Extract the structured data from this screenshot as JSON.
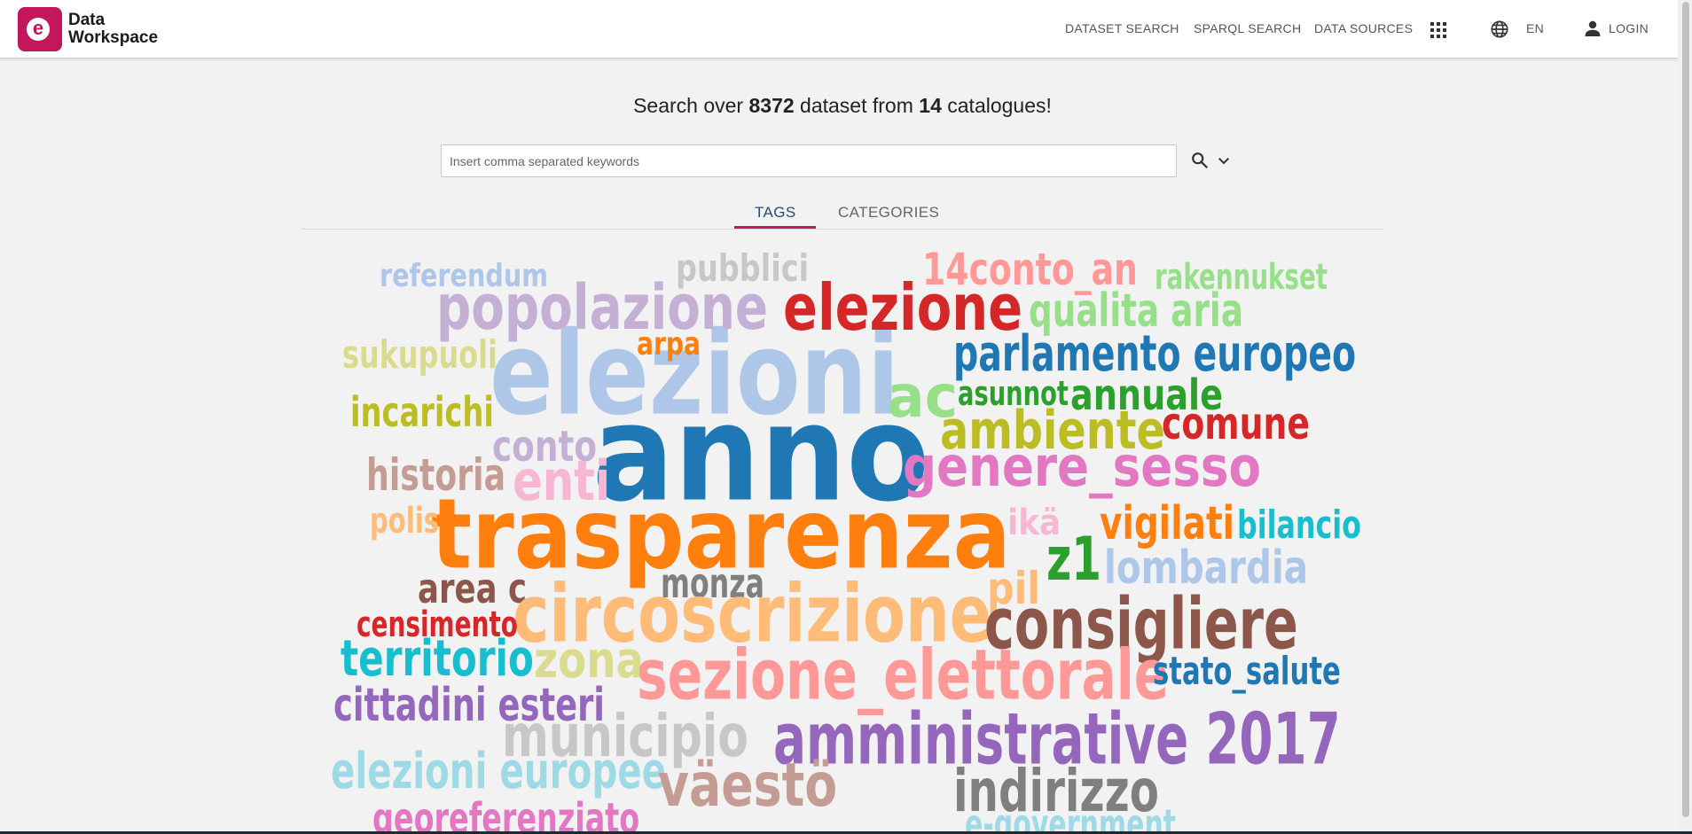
{
  "app": {
    "logo_letter": "e",
    "logo_line1": "Data",
    "logo_line2": "Workspace",
    "brand_color": "#c2185b"
  },
  "nav": {
    "dataset_search": "DATASET SEARCH",
    "sparql_search": "SPARQL SEARCH",
    "data_sources": "DATA SOURCES",
    "language": "EN",
    "login": "LOGIN",
    "icons": [
      "apps-icon",
      "globe-icon",
      "person-icon"
    ]
  },
  "headline": {
    "prefix": "Search over ",
    "dataset_count": "8372",
    "middle": " dataset from ",
    "catalogue_count": "14",
    "suffix": " catalogues!"
  },
  "search": {
    "placeholder": "Insert comma separated keywords",
    "value": "",
    "icons": [
      "search-icon",
      "chevron-down-icon"
    ]
  },
  "tabs": [
    {
      "label": "TAGS",
      "active": true
    },
    {
      "label": "CATEGORIES",
      "active": false
    }
  ],
  "word_cloud": [
    {
      "text": "anno",
      "color": "#1f77b4"
    },
    {
      "text": "elezioni",
      "color": "#aec7e8"
    },
    {
      "text": "trasparenza",
      "color": "#ff7f0e"
    },
    {
      "text": "referendum",
      "color": "#aec7e8"
    },
    {
      "text": "pubblici",
      "color": "#c7c7c7"
    },
    {
      "text": "14conto_an",
      "color": "#ff9896"
    },
    {
      "text": "rakennukset",
      "color": "#98df8a"
    },
    {
      "text": "popolazione",
      "color": "#c5b0d5"
    },
    {
      "text": "elezione",
      "color": "#d62728"
    },
    {
      "text": "qualita aria",
      "color": "#98df8a"
    },
    {
      "text": "sukupuoli",
      "color": "#dbdb8d"
    },
    {
      "text": "arpa",
      "color": "#ff7f0e"
    },
    {
      "text": "parlamento europeo",
      "color": "#1f77b4"
    },
    {
      "text": "ac",
      "color": "#98df8a"
    },
    {
      "text": "asunnot",
      "color": "#2ca02c"
    },
    {
      "text": "annuale",
      "color": "#2ca02c"
    },
    {
      "text": "incarichi",
      "color": "#bcbd22"
    },
    {
      "text": "ambiente",
      "color": "#bcbd22"
    },
    {
      "text": "comune",
      "color": "#d62728"
    },
    {
      "text": "conto",
      "color": "#c5b0d5"
    },
    {
      "text": "genere_sesso",
      "color": "#e377c2"
    },
    {
      "text": "historia",
      "color": "#c49c94"
    },
    {
      "text": "enti",
      "color": "#f7b6d2"
    },
    {
      "text": "polis",
      "color": "#ffbb78"
    },
    {
      "text": "ikä",
      "color": "#f7b6d2"
    },
    {
      "text": "vigilati",
      "color": "#ff7f0e"
    },
    {
      "text": "bilancio",
      "color": "#17becf"
    },
    {
      "text": "z1",
      "color": "#2ca02c"
    },
    {
      "text": "lombardia",
      "color": "#aec7e8"
    },
    {
      "text": "area c",
      "color": "#8c564b"
    },
    {
      "text": "monza",
      "color": "#7f7f7f"
    },
    {
      "text": "pil",
      "color": "#ffbb78"
    },
    {
      "text": "circoscrizione",
      "color": "#ffbb78"
    },
    {
      "text": "consigliere",
      "color": "#8c564b"
    },
    {
      "text": "censimento",
      "color": "#d62728"
    },
    {
      "text": "territorio",
      "color": "#17becf"
    },
    {
      "text": "zona",
      "color": "#dbdb8d"
    },
    {
      "text": "sezione_elettorale",
      "color": "#ff9896"
    },
    {
      "text": "stato_salute",
      "color": "#1f77b4"
    },
    {
      "text": "cittadini esteri",
      "color": "#9467bd"
    },
    {
      "text": "municipio",
      "color": "#c7c7c7"
    },
    {
      "text": "amministrative 2017",
      "color": "#9467bd"
    },
    {
      "text": "elezioni europee",
      "color": "#9edae5"
    },
    {
      "text": "väestö",
      "color": "#c49c94"
    },
    {
      "text": "indirizzo",
      "color": "#7f7f7f"
    },
    {
      "text": "georeferenziato",
      "color": "#e377c2"
    },
    {
      "text": "e-government",
      "color": "#9edae5"
    }
  ]
}
